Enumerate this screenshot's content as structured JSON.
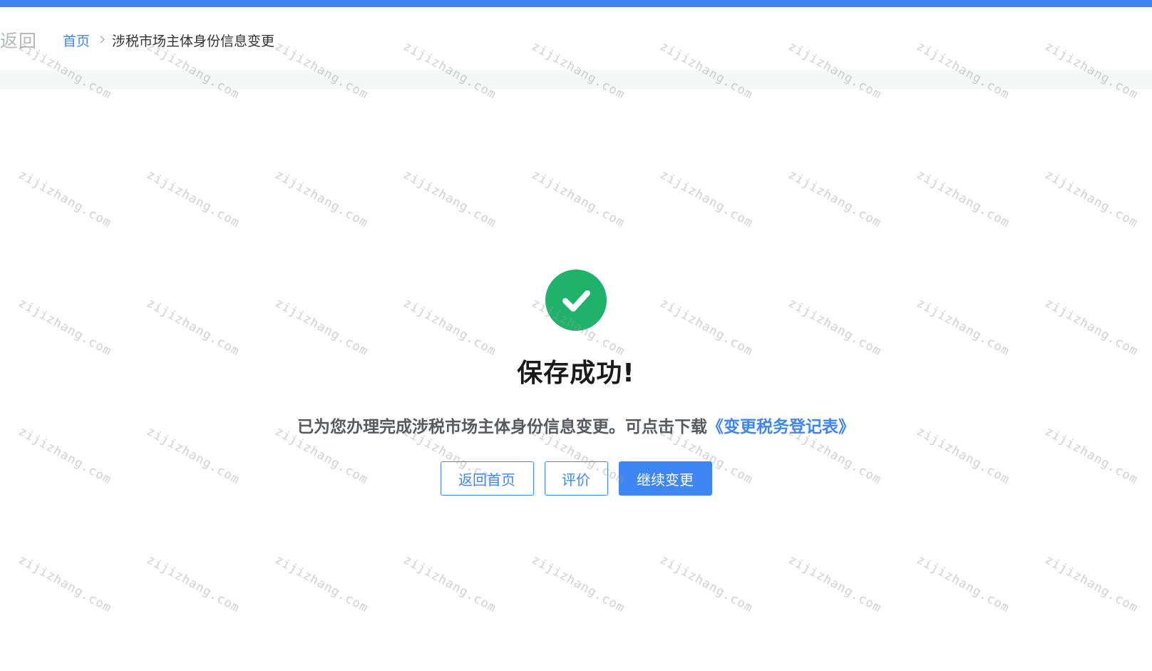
{
  "header": {
    "back_label": "返回",
    "breadcrumb": {
      "home": "首页",
      "current": "涉税市场主体身份信息变更"
    }
  },
  "result": {
    "icon": "check-circle-icon",
    "title": "保存成功!",
    "description": "已为您办理完成涉税市场主体身份信息变更。可点击下载",
    "download_link": "《变更税务登记表》"
  },
  "actions": {
    "home_label": "返回首页",
    "rate_label": "评价",
    "continue_label": "继续变更"
  },
  "watermark": {
    "text": "zijizhang.com"
  },
  "colors": {
    "primary": "#3f86f5",
    "success": "#1fb26b",
    "title": "#1a1a1a",
    "description": "#555a61"
  }
}
